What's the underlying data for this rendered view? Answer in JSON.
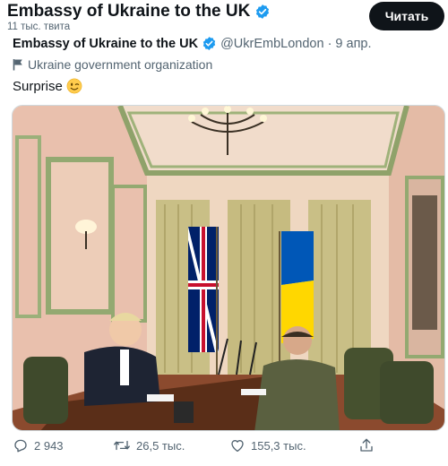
{
  "header": {
    "title": "Embassy of Ukraine to the UK",
    "tweet_count": "11 тыс. твита",
    "follow_label": "Читать"
  },
  "tweet": {
    "author_name": "Embassy of Ukraine to the UK",
    "handle": "@UkrEmbLondon",
    "separator": "·",
    "date": "9 апр.",
    "affiliation_icon": "flag-icon",
    "affiliation": "Ukraine government organization",
    "text": "Surprise",
    "emoji": "winking-face-emoji",
    "image": "meeting-photo"
  },
  "actions": {
    "replies": "2 943",
    "retweets": "26,5 тыс.",
    "likes": "155,3 тыс."
  },
  "colors": {
    "text": "#0f1419",
    "secondary": "#536471",
    "verified": "#1d9bf0",
    "button_bg": "#0f1419"
  }
}
